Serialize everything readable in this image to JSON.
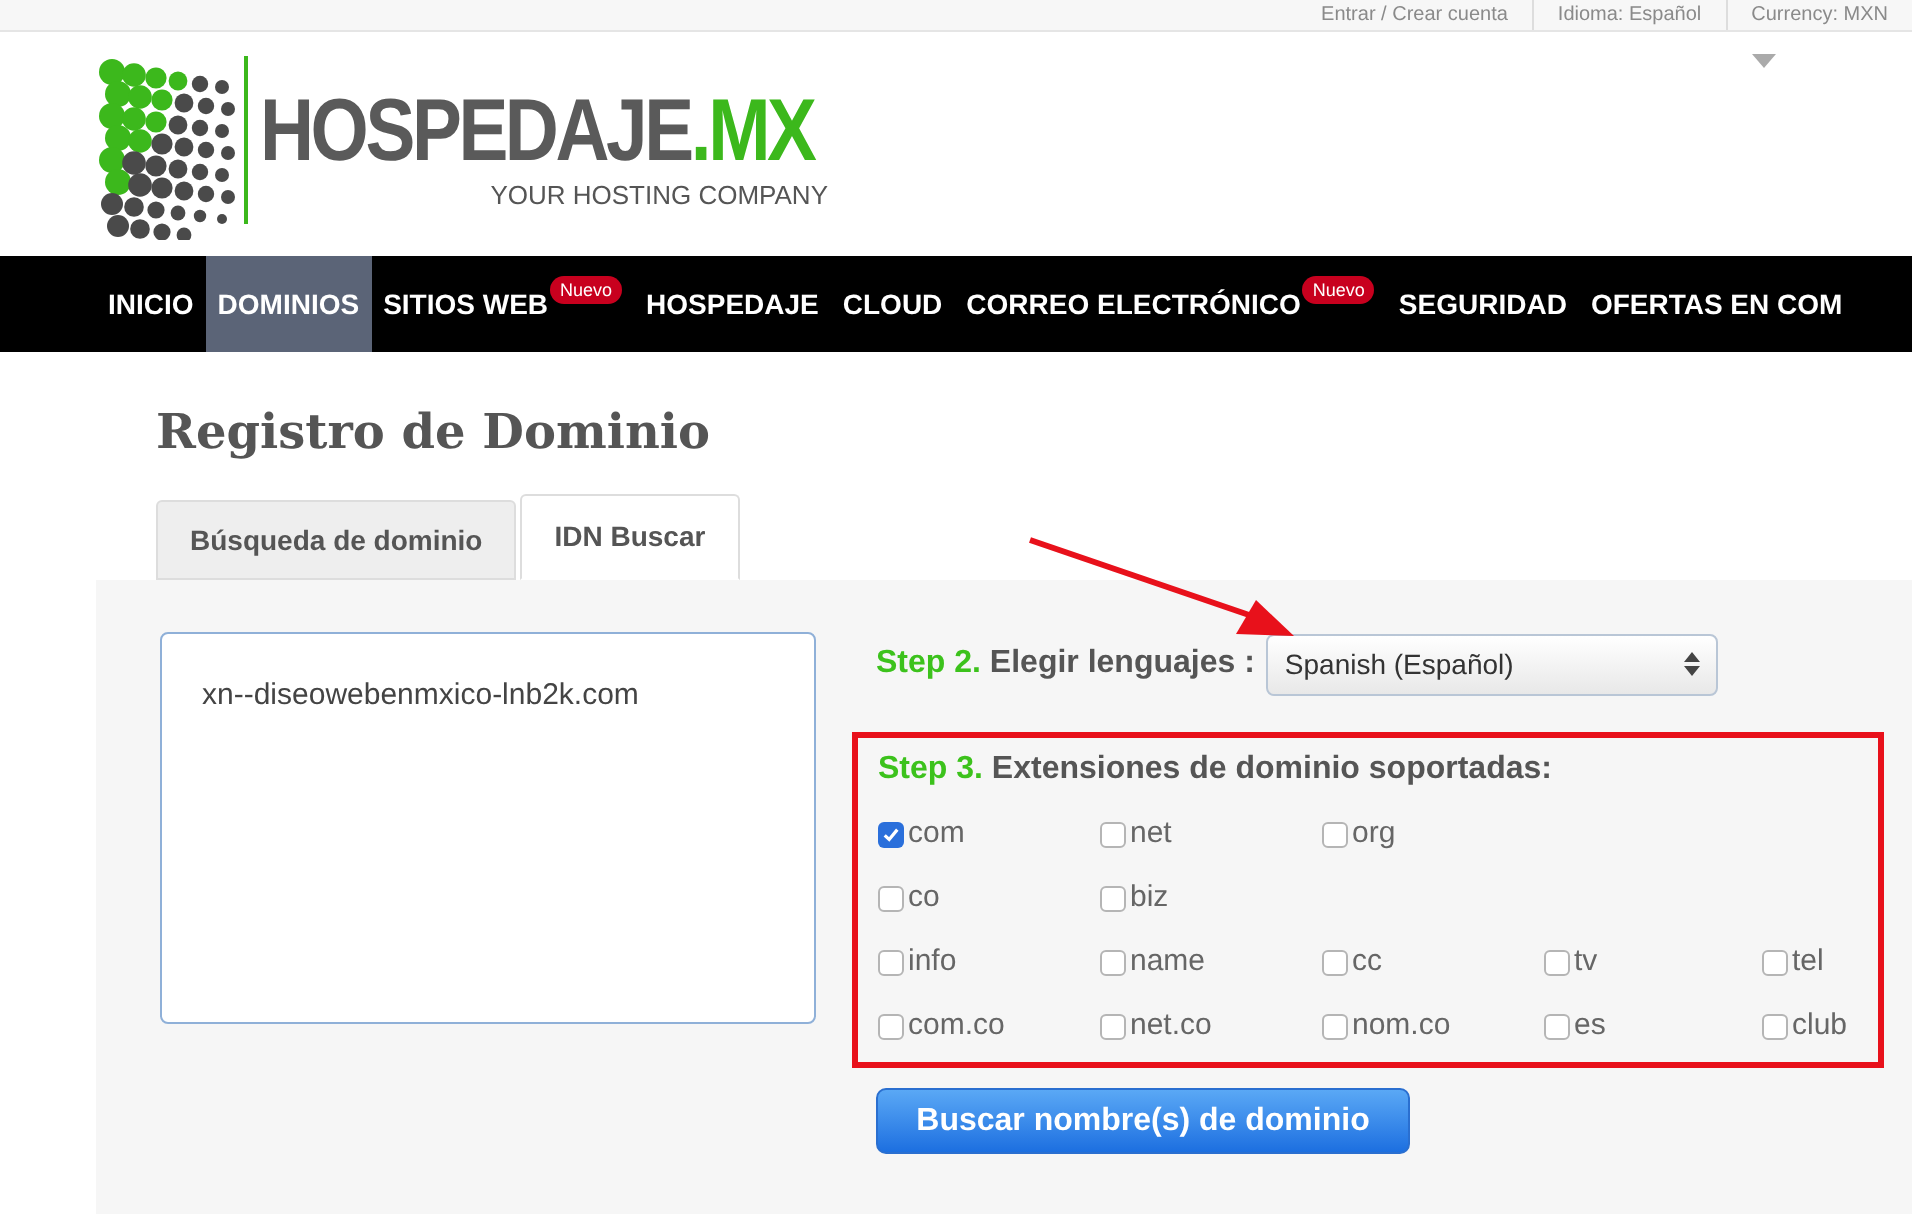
{
  "top_bar": {
    "links": [
      "Entrar / Crear cuenta",
      "Idioma: Español",
      "Currency: MXN"
    ]
  },
  "logo": {
    "name": "HOSPEDAJE",
    "suffix": ".MX",
    "tagline": "YOUR HOSTING COMPANY"
  },
  "nav": [
    {
      "label": "INICIO",
      "selected": false
    },
    {
      "label": "DOMINIOS",
      "selected": true
    },
    {
      "label": "SITIOS WEB",
      "selected": false,
      "badge": "Nuevo"
    },
    {
      "label": "HOSPEDAJE",
      "selected": false
    },
    {
      "label": "CLOUD",
      "selected": false
    },
    {
      "label": "CORREO ELECTRÓNICO",
      "selected": false,
      "badge": "Nuevo"
    },
    {
      "label": "SEGURIDAD",
      "selected": false
    },
    {
      "label": "OFERTAS EN COM",
      "selected": false
    }
  ],
  "page_title": "Registro de Dominio",
  "tabs": [
    {
      "label": "Búsqueda de dominio",
      "selected": false
    },
    {
      "label": "IDN Buscar",
      "selected": true
    }
  ],
  "domain_input": {
    "value": "xn--diseowebenmxico-lnb2k.com"
  },
  "step2": {
    "step": "Step 2.",
    "label": "Elegir lenguajes :",
    "value": "Spanish (Español)"
  },
  "step3": {
    "step": "Step 3.",
    "label": "Extensiones de dominio soportadas:",
    "rows": [
      [
        {
          "label": "com",
          "checked": true
        },
        {
          "label": "net",
          "checked": false
        },
        {
          "label": "org",
          "checked": false
        }
      ],
      [
        {
          "label": "co",
          "checked": false
        },
        {
          "label": "biz",
          "checked": false
        }
      ],
      [
        {
          "label": "info",
          "checked": false
        },
        {
          "label": "name",
          "checked": false
        },
        {
          "label": "cc",
          "checked": false
        },
        {
          "label": "tv",
          "checked": false
        },
        {
          "label": "tel",
          "checked": false
        }
      ],
      [
        {
          "label": "com.co",
          "checked": false
        },
        {
          "label": "net.co",
          "checked": false
        },
        {
          "label": "nom.co",
          "checked": false
        },
        {
          "label": "es",
          "checked": false
        },
        {
          "label": "club",
          "checked": false
        }
      ]
    ]
  },
  "search_button": "Buscar nombre(s) de dominio"
}
